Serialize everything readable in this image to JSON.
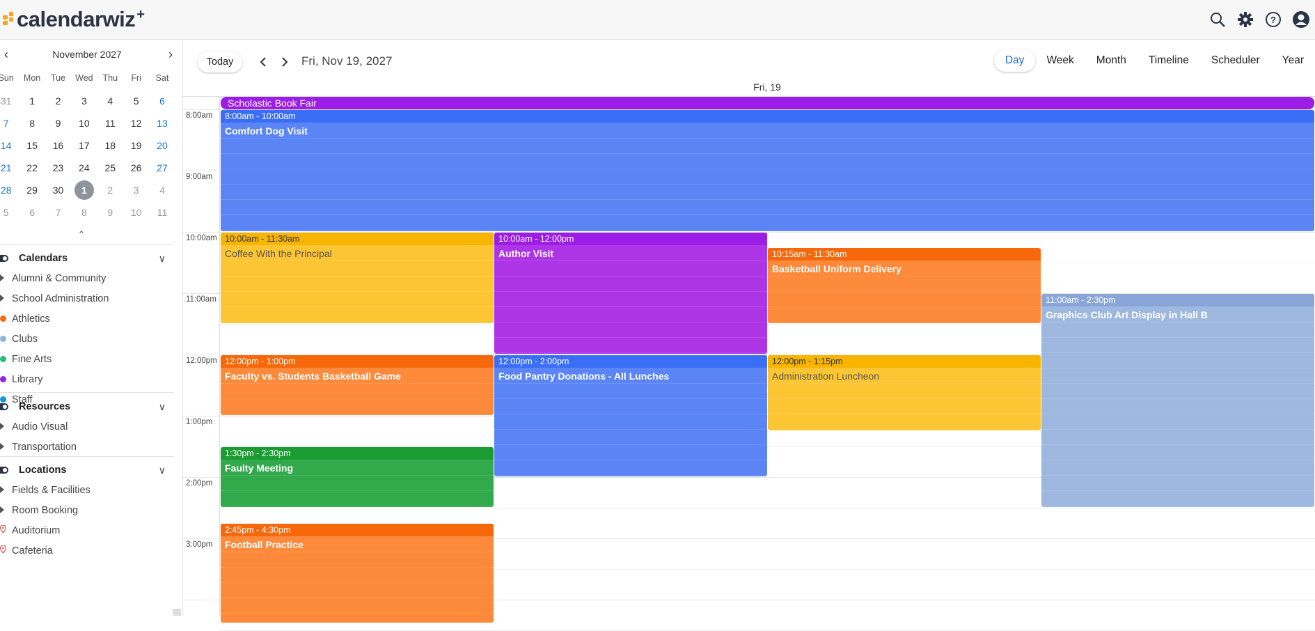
{
  "app": {
    "logo": "calendarwiz",
    "logo_plus": "+"
  },
  "top_icons": [
    "search-icon",
    "gear-icon",
    "help-icon",
    "user-icon"
  ],
  "mini_calendar": {
    "title": "November 2027",
    "dow": [
      "Sun",
      "Mon",
      "Tue",
      "Wed",
      "Thu",
      "Fri",
      "Sat"
    ],
    "weeks": [
      [
        {
          "d": "31",
          "s": "muted"
        },
        {
          "d": "1"
        },
        {
          "d": "2"
        },
        {
          "d": "3"
        },
        {
          "d": "4"
        },
        {
          "d": "5"
        },
        {
          "d": "6",
          "s": "blue"
        }
      ],
      [
        {
          "d": "7",
          "s": "blue"
        },
        {
          "d": "8"
        },
        {
          "d": "9"
        },
        {
          "d": "10"
        },
        {
          "d": "11"
        },
        {
          "d": "12"
        },
        {
          "d": "13",
          "s": "blue"
        }
      ],
      [
        {
          "d": "14",
          "s": "blue"
        },
        {
          "d": "15"
        },
        {
          "d": "16"
        },
        {
          "d": "17"
        },
        {
          "d": "18"
        },
        {
          "d": "19"
        },
        {
          "d": "20",
          "s": "blue"
        }
      ],
      [
        {
          "d": "21",
          "s": "blue"
        },
        {
          "d": "22"
        },
        {
          "d": "23"
        },
        {
          "d": "24"
        },
        {
          "d": "25"
        },
        {
          "d": "26"
        },
        {
          "d": "27",
          "s": "blue"
        }
      ],
      [
        {
          "d": "28",
          "s": "blue"
        },
        {
          "d": "29"
        },
        {
          "d": "30"
        },
        {
          "d": "1",
          "s": "sel"
        },
        {
          "d": "2",
          "s": "muted"
        },
        {
          "d": "3",
          "s": "muted"
        },
        {
          "d": "4",
          "s": "muted"
        }
      ],
      [
        {
          "d": "5",
          "s": "muted"
        },
        {
          "d": "6",
          "s": "muted"
        },
        {
          "d": "7",
          "s": "muted"
        },
        {
          "d": "8",
          "s": "muted"
        },
        {
          "d": "9",
          "s": "muted"
        },
        {
          "d": "10",
          "s": "muted"
        },
        {
          "d": "11",
          "s": "muted"
        }
      ]
    ]
  },
  "sections": {
    "calendars": {
      "title": "Calendars",
      "items": [
        {
          "label": "Alumni & Community",
          "marker": "triangle"
        },
        {
          "label": "School Administration",
          "marker": "triangle"
        },
        {
          "label": "Athletics",
          "marker": "dot",
          "color": "#f36c0f"
        },
        {
          "label": "Clubs",
          "marker": "dot",
          "color": "#8fb0e0"
        },
        {
          "label": "Fine Arts",
          "marker": "dot",
          "color": "#1fc07a"
        },
        {
          "label": "Library",
          "marker": "dot",
          "color": "#9b1de6"
        },
        {
          "label": "Staff",
          "marker": "dot",
          "color": "#1296dc"
        }
      ]
    },
    "resources": {
      "title": "Resources",
      "items": [
        {
          "label": "Audio Visual",
          "marker": "triangle"
        },
        {
          "label": "Transportation",
          "marker": "triangle"
        }
      ]
    },
    "locations": {
      "title": "Locations",
      "items": [
        {
          "label": "Fields & Facilities",
          "marker": "triangle"
        },
        {
          "label": "Room Booking",
          "marker": "triangle"
        },
        {
          "label": "Auditorium",
          "marker": "pin"
        },
        {
          "label": "Cafeteria",
          "marker": "pin"
        }
      ]
    }
  },
  "toolbar": {
    "today": "Today",
    "date_label": "Fri, Nov 19, 2027",
    "views": [
      "Day",
      "Week",
      "Month",
      "Timeline",
      "Scheduler",
      "Year"
    ],
    "active_view": "Day"
  },
  "day_header": "Fri, 19",
  "time_labels": [
    "8:00am",
    "9:00am",
    "10:00am",
    "11:00am",
    "12:00pm",
    "1:00pm",
    "2:00pm",
    "3:00pm"
  ],
  "allday_event": {
    "title": "Scholastic Book Fair",
    "color": "#9b1de6"
  },
  "colors": {
    "blue": {
      "head": "#3b6ef7",
      "body": "#5b85f5"
    },
    "yellow": {
      "head": "#f7b500",
      "body": "#fcc534"
    },
    "purple": {
      "head": "#9b1de6",
      "body": "#ad35e6"
    },
    "orange": {
      "head": "#f7680b",
      "body": "#fd893a"
    },
    "lightblue": {
      "head": "#8aa6d8",
      "body": "#9eb8e0"
    },
    "green": {
      "head": "#1b9c32",
      "body": "#32aa4c"
    }
  },
  "events": [
    {
      "time": "8:00am - 10:00am",
      "title": "Comfort Dog Visit",
      "color": "blue",
      "start": 8.0,
      "end": 10.0,
      "col": 0,
      "span": 4
    },
    {
      "time": "10:00am - 11:30am",
      "title": "Coffee With the Principal",
      "color": "yellow",
      "start": 10.0,
      "end": 11.5,
      "col": 0,
      "span": 1
    },
    {
      "time": "10:00am - 12:00pm",
      "title": "Author Visit",
      "color": "purple",
      "start": 10.0,
      "end": 12.0,
      "col": 1,
      "span": 1
    },
    {
      "time": "10:15am - 11:30am",
      "title": "Basketball Uniform Delivery",
      "color": "orange",
      "start": 10.25,
      "end": 11.5,
      "col": 2,
      "span": 1
    },
    {
      "time": "11:00am - 2:30pm",
      "title": "Graphics Club Art Display in Hall B",
      "color": "lightblue",
      "start": 11.0,
      "end": 14.5,
      "col": 3,
      "span": 1
    },
    {
      "time": "12:00pm - 1:00pm",
      "title": "Faculty vs. Students Basketball Game",
      "color": "orange",
      "start": 12.0,
      "end": 13.0,
      "col": 0,
      "span": 1
    },
    {
      "time": "12:00pm - 2:00pm",
      "title": "Food Pantry Donations - All Lunches",
      "color": "blue",
      "start": 12.0,
      "end": 14.0,
      "col": 1,
      "span": 1
    },
    {
      "time": "12:00pm - 1:15pm",
      "title": "Administration Luncheon",
      "color": "yellow",
      "start": 12.0,
      "end": 13.25,
      "col": 2,
      "span": 1
    },
    {
      "time": "1:30pm - 2:30pm",
      "title": "Faulty Meeting",
      "color": "green",
      "start": 13.5,
      "end": 14.5,
      "col": 0,
      "span": 1
    },
    {
      "time": "2:45pm - 4:30pm",
      "title": "Football Practice",
      "color": "orange",
      "start": 14.75,
      "end": 16.5,
      "col": 0,
      "span": 1
    }
  ]
}
